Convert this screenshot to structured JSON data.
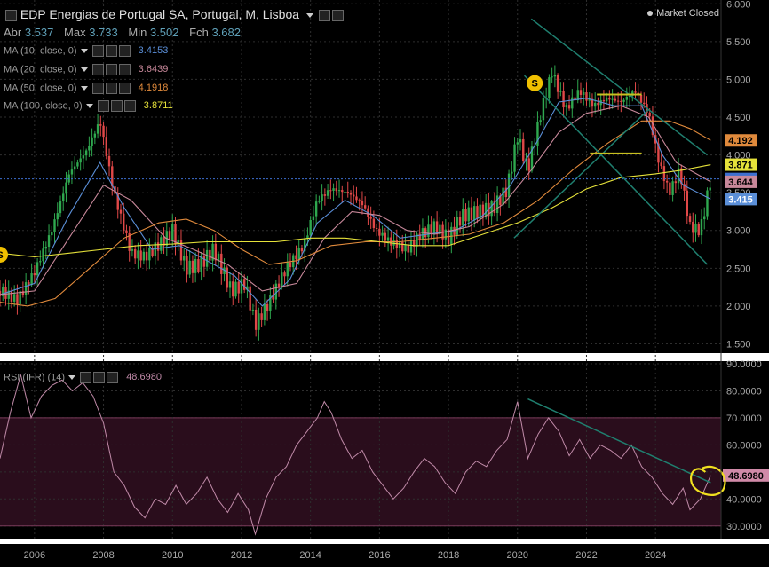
{
  "header": {
    "title": "EDP Energias de Portugal SA, Portugal, M, Lisboa",
    "market_status": "Market Closed",
    "ohlc": {
      "open_label": "Abr",
      "open": "3.537",
      "high_label": "Max",
      "high": "3.733",
      "low_label": "Min",
      "low": "3.502",
      "close_label": "Fch",
      "close": "3.682"
    }
  },
  "indicators": [
    {
      "label": "MA (10, close, 0)",
      "value": "3.4153",
      "color": "#5b8fd8"
    },
    {
      "label": "MA (20, close, 0)",
      "value": "3.6439",
      "color": "#c8889a"
    },
    {
      "label": "MA (50, close, 0)",
      "value": "4.1918",
      "color": "#e08a3c"
    },
    {
      "label": "MA (100, close, 0)",
      "value": "3.8711",
      "color": "#e6e23a"
    }
  ],
  "rsi": {
    "label": "RSI (IFR) (14)",
    "value": "48.6980",
    "color": "#c08aa8"
  },
  "colors": {
    "up": "#2fa84f",
    "down": "#e04848",
    "grid": "#2e2e2e",
    "trend": "#1f7f6f",
    "last_price": "#3d6fd0",
    "highlight": "#f0e020",
    "band": "#2a0d1c"
  },
  "chart_data": [
    {
      "type": "candlestick",
      "title": "EDP Energias de Portugal SA, Portugal, M, Lisboa",
      "x_axis_labels": [
        "2006",
        "2008",
        "2010",
        "2012",
        "2014",
        "2016",
        "2018",
        "2020",
        "2022",
        "2024"
      ],
      "x_range": [
        2005.0,
        2025.9
      ],
      "ylim": [
        1.4,
        6.05
      ],
      "y_tick_labels": [
        "6.000",
        "5.500",
        "5.000",
        "4.500",
        "4.000",
        "3.500",
        "3.000",
        "2.500",
        "2.000",
        "1.500"
      ],
      "grid": true,
      "price_tags": [
        {
          "value": 4.192,
          "label": "4.192",
          "bg": "#e08a3c",
          "fg": "#000000"
        },
        {
          "value": 3.871,
          "label": "3.871",
          "bg": "#e6e23a",
          "fg": "#000000"
        },
        {
          "value": 3.682,
          "label": "3.682",
          "bg": "#3d6fd0",
          "fg": "#ffffff"
        },
        {
          "value": 3.644,
          "label": "3.644",
          "bg": "#c8889a",
          "fg": "#000000"
        },
        {
          "value": 3.415,
          "label": "3.415",
          "bg": "#5b8fd8",
          "fg": "#ffffff"
        }
      ],
      "last_close": 3.682,
      "close_path": [
        [
          2005.0,
          2.2
        ],
        [
          2005.5,
          2.08
        ],
        [
          2006.0,
          2.45
        ],
        [
          2006.5,
          3.0
        ],
        [
          2007.0,
          3.75
        ],
        [
          2007.5,
          4.05
        ],
        [
          2007.9,
          4.45
        ],
        [
          2008.3,
          3.5
        ],
        [
          2008.8,
          2.7
        ],
        [
          2009.2,
          2.65
        ],
        [
          2009.7,
          2.85
        ],
        [
          2010.0,
          3.0
        ],
        [
          2010.4,
          2.5
        ],
        [
          2010.8,
          2.55
        ],
        [
          2011.2,
          2.75
        ],
        [
          2011.7,
          2.2
        ],
        [
          2012.1,
          2.3
        ],
        [
          2012.4,
          1.75
        ],
        [
          2012.8,
          2.05
        ],
        [
          2013.3,
          2.5
        ],
        [
          2013.8,
          2.8
        ],
        [
          2014.2,
          3.4
        ],
        [
          2014.6,
          3.55
        ],
        [
          2015.1,
          3.5
        ],
        [
          2015.5,
          3.35
        ],
        [
          2015.9,
          3.0
        ],
        [
          2016.3,
          2.85
        ],
        [
          2016.8,
          2.75
        ],
        [
          2017.2,
          2.95
        ],
        [
          2017.6,
          3.05
        ],
        [
          2018.0,
          2.9
        ],
        [
          2018.4,
          3.2
        ],
        [
          2018.9,
          3.25
        ],
        [
          2019.3,
          3.3
        ],
        [
          2019.7,
          3.55
        ],
        [
          2020.0,
          4.25
        ],
        [
          2020.3,
          3.8
        ],
        [
          2020.7,
          4.6
        ],
        [
          2021.0,
          5.1
        ],
        [
          2021.4,
          4.6
        ],
        [
          2021.8,
          4.85
        ],
        [
          2022.2,
          4.65
        ],
        [
          2022.6,
          4.75
        ],
        [
          2023.0,
          4.7
        ],
        [
          2023.4,
          4.85
        ],
        [
          2023.8,
          4.55
        ],
        [
          2024.1,
          3.9
        ],
        [
          2024.4,
          3.5
        ],
        [
          2024.7,
          3.8
        ],
        [
          2025.0,
          3.05
        ],
        [
          2025.3,
          3.0
        ],
        [
          2025.6,
          3.682
        ]
      ],
      "moving_averages": [
        {
          "name": "MA (10, close, 0)",
          "color": "#5b8fd8",
          "points": [
            [
              2005.0,
              2.15
            ],
            [
              2006.0,
              2.3
            ],
            [
              2007.0,
              3.2
            ],
            [
              2007.9,
              3.9
            ],
            [
              2008.6,
              3.3
            ],
            [
              2009.4,
              2.75
            ],
            [
              2010.2,
              2.8
            ],
            [
              2011.0,
              2.6
            ],
            [
              2011.8,
              2.4
            ],
            [
              2012.6,
              2.0
            ],
            [
              2013.4,
              2.35
            ],
            [
              2014.2,
              3.1
            ],
            [
              2015.0,
              3.4
            ],
            [
              2015.8,
              3.2
            ],
            [
              2016.6,
              2.9
            ],
            [
              2017.4,
              2.95
            ],
            [
              2018.2,
              3.0
            ],
            [
              2019.0,
              3.2
            ],
            [
              2019.8,
              3.6
            ],
            [
              2020.6,
              4.2
            ],
            [
              2021.2,
              4.7
            ],
            [
              2022.0,
              4.75
            ],
            [
              2022.8,
              4.65
            ],
            [
              2023.6,
              4.65
            ],
            [
              2024.2,
              4.0
            ],
            [
              2024.8,
              3.6
            ],
            [
              2025.6,
              3.415
            ]
          ]
        },
        {
          "name": "MA (20, close, 0)",
          "color": "#c8889a",
          "points": [
            [
              2005.0,
              2.15
            ],
            [
              2006.0,
              2.2
            ],
            [
              2007.0,
              2.9
            ],
            [
              2008.0,
              3.6
            ],
            [
              2008.8,
              3.4
            ],
            [
              2009.8,
              2.9
            ],
            [
              2010.6,
              2.75
            ],
            [
              2011.6,
              2.55
            ],
            [
              2012.6,
              2.2
            ],
            [
              2013.6,
              2.3
            ],
            [
              2014.4,
              2.9
            ],
            [
              2015.2,
              3.25
            ],
            [
              2016.0,
              3.2
            ],
            [
              2016.8,
              3.0
            ],
            [
              2017.6,
              2.95
            ],
            [
              2018.6,
              3.05
            ],
            [
              2019.6,
              3.35
            ],
            [
              2020.4,
              3.8
            ],
            [
              2021.2,
              4.3
            ],
            [
              2022.0,
              4.55
            ],
            [
              2023.0,
              4.65
            ],
            [
              2023.8,
              4.5
            ],
            [
              2024.6,
              3.9
            ],
            [
              2025.6,
              3.644
            ]
          ]
        },
        {
          "name": "MA (50, close, 0)",
          "color": "#e08a3c",
          "points": [
            [
              2005.0,
              2.05
            ],
            [
              2005.8,
              2.0
            ],
            [
              2006.6,
              2.1
            ],
            [
              2007.6,
              2.5
            ],
            [
              2008.6,
              2.9
            ],
            [
              2009.6,
              3.1
            ],
            [
              2010.4,
              3.15
            ],
            [
              2011.2,
              3.0
            ],
            [
              2012.0,
              2.75
            ],
            [
              2012.8,
              2.55
            ],
            [
              2013.6,
              2.6
            ],
            [
              2014.6,
              2.8
            ],
            [
              2015.6,
              2.85
            ],
            [
              2016.6,
              2.85
            ],
            [
              2017.6,
              2.9
            ],
            [
              2018.6,
              2.95
            ],
            [
              2019.6,
              3.1
            ],
            [
              2020.6,
              3.4
            ],
            [
              2021.6,
              3.8
            ],
            [
              2022.6,
              4.15
            ],
            [
              2023.6,
              4.45
            ],
            [
              2024.4,
              4.45
            ],
            [
              2025.0,
              4.35
            ],
            [
              2025.6,
              4.192
            ]
          ]
        },
        {
          "name": "MA (100, close, 0)",
          "color": "#e6e23a",
          "points": [
            [
              2005.0,
              2.7
            ],
            [
              2006.0,
              2.65
            ],
            [
              2007.0,
              2.7
            ],
            [
              2008.0,
              2.75
            ],
            [
              2009.0,
              2.8
            ],
            [
              2010.0,
              2.82
            ],
            [
              2011.0,
              2.85
            ],
            [
              2012.0,
              2.85
            ],
            [
              2013.0,
              2.85
            ],
            [
              2014.0,
              2.9
            ],
            [
              2015.0,
              2.9
            ],
            [
              2016.0,
              2.85
            ],
            [
              2017.0,
              2.8
            ],
            [
              2018.0,
              2.8
            ],
            [
              2019.0,
              2.95
            ],
            [
              2020.0,
              3.1
            ],
            [
              2021.0,
              3.3
            ],
            [
              2022.0,
              3.55
            ],
            [
              2023.0,
              3.7
            ],
            [
              2024.0,
              3.75
            ],
            [
              2024.8,
              3.8
            ],
            [
              2025.6,
              3.871
            ]
          ]
        }
      ],
      "trend_lines": [
        [
          [
            2020.4,
            5.8
          ],
          [
            2025.5,
            4.0
          ]
        ],
        [
          [
            2020.2,
            5.05
          ],
          [
            2025.5,
            2.55
          ]
        ],
        [
          [
            2019.9,
            2.9
          ],
          [
            2023.8,
            4.6
          ]
        ]
      ],
      "level_lines": [
        [
          [
            2022.3,
            4.8
          ],
          [
            2023.6,
            4.8
          ]
        ],
        [
          [
            2022.1,
            4.02
          ],
          [
            2023.6,
            4.02
          ]
        ]
      ],
      "markers": [
        {
          "label": "S",
          "x": 2005.0,
          "y": 2.68
        },
        {
          "label": "S",
          "x": 2020.5,
          "y": 4.95
        }
      ]
    },
    {
      "type": "line",
      "title": "RSI (IFR) (14)",
      "ylim": [
        25,
        90
      ],
      "y_tick_labels": [
        "90.0000",
        "80.0000",
        "70.0000",
        "60.0000",
        "50.0000",
        "40.0000",
        "30.0000"
      ],
      "band": [
        30,
        70
      ],
      "current_value_label": "48.6980",
      "series": [
        {
          "name": "RSI (IFR) (14)",
          "points": [
            [
              2005.0,
              55
            ],
            [
              2005.3,
              72
            ],
            [
              2005.6,
              86
            ],
            [
              2005.9,
              70
            ],
            [
              2006.2,
              78
            ],
            [
              2006.5,
              82
            ],
            [
              2006.8,
              84
            ],
            [
              2007.1,
              80
            ],
            [
              2007.4,
              83
            ],
            [
              2007.7,
              78
            ],
            [
              2008.0,
              68
            ],
            [
              2008.3,
              50
            ],
            [
              2008.6,
              45
            ],
            [
              2008.9,
              37
            ],
            [
              2009.2,
              33
            ],
            [
              2009.5,
              40
            ],
            [
              2009.8,
              38
            ],
            [
              2010.1,
              45
            ],
            [
              2010.4,
              38
            ],
            [
              2010.7,
              42
            ],
            [
              2011.0,
              48
            ],
            [
              2011.3,
              40
            ],
            [
              2011.6,
              35
            ],
            [
              2011.9,
              42
            ],
            [
              2012.2,
              36
            ],
            [
              2012.4,
              27
            ],
            [
              2012.7,
              40
            ],
            [
              2013.0,
              48
            ],
            [
              2013.3,
              52
            ],
            [
              2013.6,
              60
            ],
            [
              2013.9,
              65
            ],
            [
              2014.2,
              70
            ],
            [
              2014.4,
              76
            ],
            [
              2014.6,
              72
            ],
            [
              2014.9,
              62
            ],
            [
              2015.2,
              55
            ],
            [
              2015.5,
              58
            ],
            [
              2015.8,
              50
            ],
            [
              2016.1,
              45
            ],
            [
              2016.4,
              40
            ],
            [
              2016.7,
              44
            ],
            [
              2017.0,
              50
            ],
            [
              2017.3,
              55
            ],
            [
              2017.6,
              52
            ],
            [
              2017.9,
              46
            ],
            [
              2018.2,
              42
            ],
            [
              2018.5,
              50
            ],
            [
              2018.8,
              54
            ],
            [
              2019.1,
              52
            ],
            [
              2019.4,
              58
            ],
            [
              2019.7,
              62
            ],
            [
              2020.0,
              76
            ],
            [
              2020.3,
              55
            ],
            [
              2020.6,
              64
            ],
            [
              2020.9,
              70
            ],
            [
              2021.2,
              65
            ],
            [
              2021.5,
              56
            ],
            [
              2021.8,
              62
            ],
            [
              2022.1,
              55
            ],
            [
              2022.4,
              60
            ],
            [
              2022.7,
              58
            ],
            [
              2023.0,
              55
            ],
            [
              2023.3,
              60
            ],
            [
              2023.6,
              52
            ],
            [
              2023.9,
              48
            ],
            [
              2024.2,
              42
            ],
            [
              2024.5,
              38
            ],
            [
              2024.8,
              44
            ],
            [
              2025.0,
              36
            ],
            [
              2025.3,
              40
            ],
            [
              2025.6,
              48.698
            ]
          ]
        }
      ],
      "trend_lines": [
        [
          [
            2020.3,
            77
          ],
          [
            2025.6,
            46
          ]
        ]
      ],
      "highlight": {
        "x": 2025.6,
        "y": 46
      }
    }
  ]
}
